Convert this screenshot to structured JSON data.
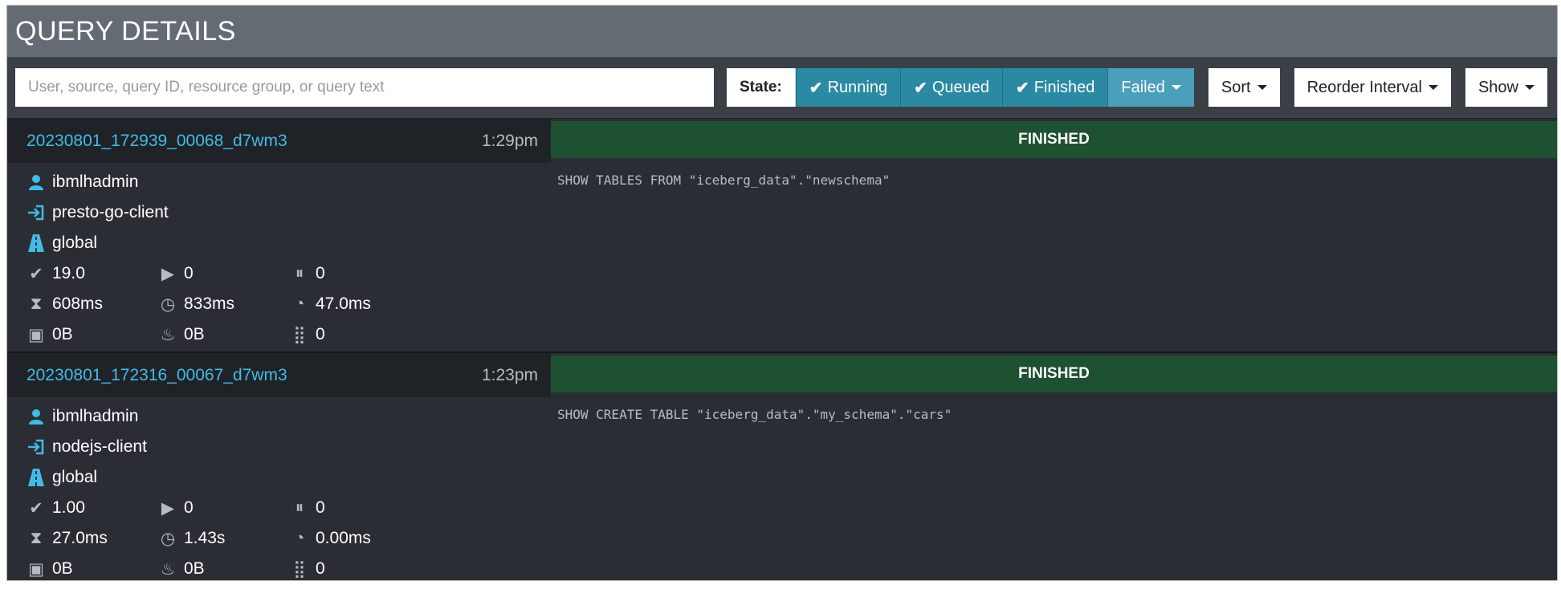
{
  "header": {
    "title": "QUERY DETAILS"
  },
  "toolbar": {
    "search_placeholder": "User, source, query ID, resource group, or query text",
    "state_label": "State:",
    "states": [
      {
        "label": "Running",
        "checked": true
      },
      {
        "label": "Queued",
        "checked": true
      },
      {
        "label": "Finished",
        "checked": true
      },
      {
        "label": "Failed",
        "checked": false
      }
    ],
    "sort_label": "Sort",
    "reorder_label": "Reorder Interval",
    "show_label": "Show"
  },
  "queries": [
    {
      "id": "20230801_172939_00068_d7wm3",
      "time": "1:29pm",
      "status": "FINISHED",
      "user": "ibmlhadmin",
      "source": "presto-go-client",
      "resource_group": "global",
      "stats": {
        "completed_splits": "19.0",
        "running_splits": "0",
        "queued_splits": "0",
        "wall_time": "608ms",
        "elapsed_time": "833ms",
        "cpu_time": "47.0ms",
        "memory": "0B",
        "peak_memory": "0B",
        "input_rows": "0"
      },
      "sql": "SHOW TABLES FROM \"iceberg_data\".\"newschema\""
    },
    {
      "id": "20230801_172316_00067_d7wm3",
      "time": "1:23pm",
      "status": "FINISHED",
      "user": "ibmlhadmin",
      "source": "nodejs-client",
      "resource_group": "global",
      "stats": {
        "completed_splits": "1.00",
        "running_splits": "0",
        "queued_splits": "0",
        "wall_time": "27.0ms",
        "elapsed_time": "1.43s",
        "cpu_time": "0.00ms",
        "memory": "0B",
        "peak_memory": "0B",
        "input_rows": "0"
      },
      "sql": "SHOW CREATE TABLE \"iceberg_data\".\"my_schema\".\"cars\""
    }
  ],
  "colors": {
    "header_bg": "#656b73",
    "toolbar_bg": "#3b3f46",
    "state_button": "#2a8aa3",
    "query_id": "#3fbde6",
    "finished_bar": "#1e5131",
    "panel_bg": "#2a2d34"
  }
}
